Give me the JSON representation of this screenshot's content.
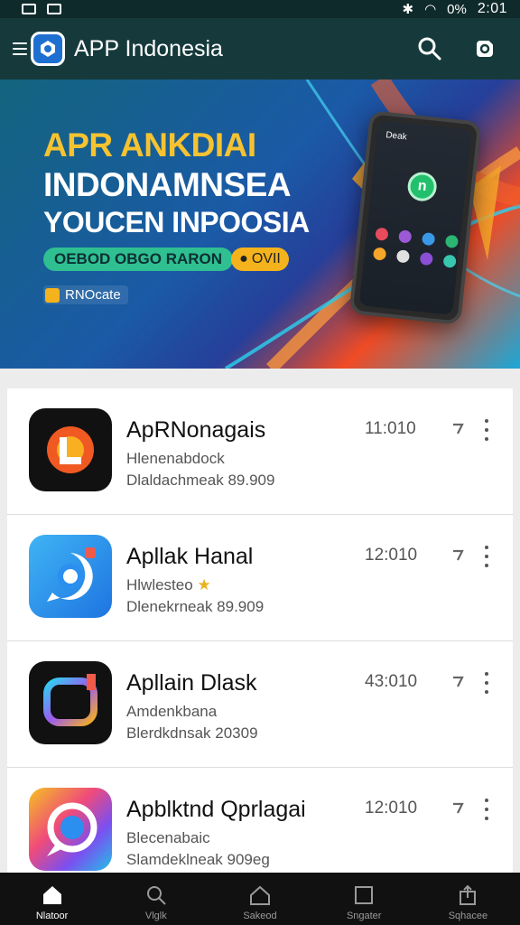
{
  "status_bar": {
    "time": "2:01",
    "battery": "0%"
  },
  "app_bar": {
    "title": "APP Indonesia"
  },
  "banner": {
    "line1": "APR ANKDIAI",
    "line2": "INDONAMNSEA",
    "line3": "YOUCEN INPOOSIA",
    "pill": "OEBOD OBGO RARON",
    "badge": "OVII",
    "small": "RNOcate",
    "phone_label": "Deak"
  },
  "apps": [
    {
      "title": "ApRNonagais",
      "subtitle1": "Hlenenabdock",
      "subtitle2": "Dlaldachmeak 89.909",
      "count": "11:010"
    },
    {
      "title": "Apllak Hanal",
      "subtitle1": "Hlwlesteo",
      "subtitle2": "Dlenekrneak 89.909",
      "count": "12:010"
    },
    {
      "title": "Apllain Dlask",
      "subtitle1": "Amdenkbana",
      "subtitle2": "Blerdkdnsak 20309",
      "count": "43:010"
    },
    {
      "title": "Apblktnd Qprlagai",
      "subtitle1": "Blecenabaic",
      "subtitle2": "Slamdeklneak 909eg",
      "count": "12:010"
    }
  ],
  "bottom_nav": [
    {
      "label": "Nlatoor",
      "icon": "home-icon"
    },
    {
      "label": "Vlglk",
      "icon": "search-icon"
    },
    {
      "label": "Sakeod",
      "icon": "house-outline-icon"
    },
    {
      "label": "Sngater",
      "icon": "square-icon"
    },
    {
      "label": "Sqhacee",
      "icon": "share-icon"
    }
  ]
}
